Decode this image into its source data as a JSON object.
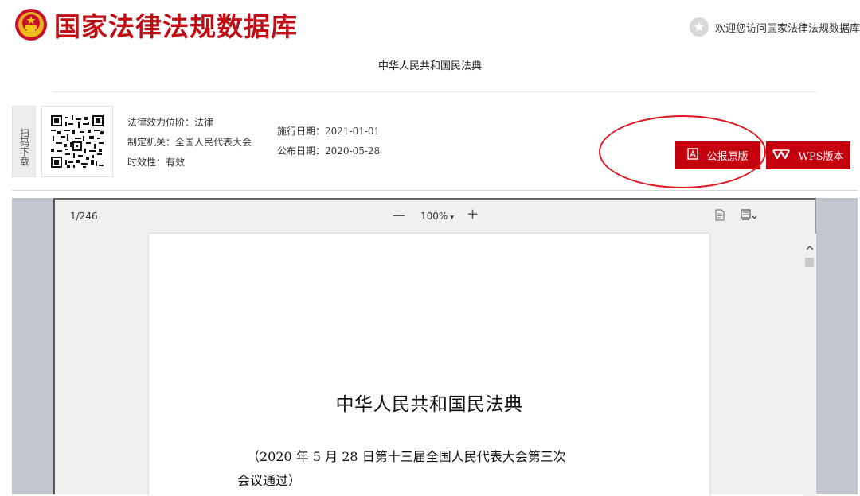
{
  "header": {
    "site_title": "国家法律法规数据库",
    "welcome_text": "欢迎您访问国家法律法规数据库"
  },
  "law": {
    "heading": "中华人民共和国民法典"
  },
  "info": {
    "scan_label": "扫码下载",
    "effect_level": "法律效力位阶：法律",
    "issuing_authority": "制定机关：全国人民代表大会",
    "validity": "时效性：有效",
    "effective_date": "施行日期：2021-01-01",
    "publish_date": "公布日期：2020-05-28"
  },
  "buttons": {
    "gazette_label": "公报原版",
    "wps_label": "WPS版本"
  },
  "viewer": {
    "page_counter": "1/246",
    "zoom_out": "—",
    "zoom_level": "100%",
    "zoom_in": "+",
    "document": {
      "title": "中华人民共和国民法典",
      "note_line1": "（2020 年 5 月 28 日第十三届全国人民代表大会第三次",
      "note_line2": "会议通过）"
    }
  },
  "colors": {
    "brand_red": "#c20d14",
    "button_red": "#c4000f",
    "annotation_red": "#e0141e"
  },
  "icons": {
    "emblem": "national-emblem-icon",
    "welcome": "star-icon",
    "gazette": "pdf-icon",
    "wps": "wps-logo-icon",
    "doc_view": "document-view-icon",
    "print": "print-icon",
    "scroll_up": "chevron-up-icon"
  }
}
